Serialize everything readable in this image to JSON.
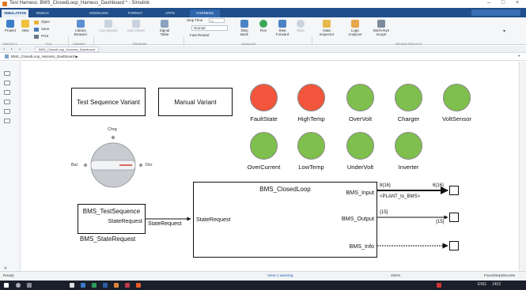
{
  "window": {
    "title": "Test Harness: BMS_ClosedLoop_Harness_Dashboard * - Simulink",
    "min": "–",
    "max": "□",
    "close": "×"
  },
  "tabs": [
    "SIMULATION",
    "DEBUG",
    "MODELING",
    "FORMAT",
    "APPS",
    "HARNESS"
  ],
  "ribbon": {
    "file": {
      "project": "Project",
      "new": "New",
      "open": "Open",
      "save": "Save",
      "print": "Print",
      "library": "Library Browser"
    },
    "prepare": {
      "log": "Log Signals",
      "add_viewer": "Add Viewer",
      "signal_table": "Signal Table"
    },
    "simulate": {
      "stop_time_label": "Stop Time",
      "stop_time": "inf",
      "mode": "Normal",
      "fast_restart": "Fast Restart",
      "step_back": "Step Back",
      "run": "Run",
      "step_fwd": "Step Forward",
      "stop": "Stop"
    },
    "review": {
      "data_inspector": "Data Inspector",
      "logic_analyzer": "Logic Analyzer",
      "bird_eye": "Bird's-Eye Scope"
    },
    "groups": [
      "PROJECT",
      "FILE",
      "LIBRARY",
      "PREPARE",
      "SIMULATE",
      "REVIEW RESULTS"
    ]
  },
  "model_tab": "BMS_ClosedLoop_Harness_Dashboard",
  "breadcrumb": "BMS_ClosedLoop_Harness_Dashboard ▶",
  "diagram": {
    "variant1": "Test Sequence Variant",
    "variant2": "Manual Variant",
    "lamps": [
      {
        "label": "FaultState",
        "color": "#f2553b"
      },
      {
        "label": "HighTemp",
        "color": "#f2553b"
      },
      {
        "label": "OverVolt",
        "color": "#7fbf4d"
      },
      {
        "label": "Charger",
        "color": "#7fbf4d"
      },
      {
        "label": "VoltSensor",
        "color": "#7fbf4d"
      },
      {
        "label": "OverCurrent",
        "color": "#7fbf4d"
      },
      {
        "label": "LowTemp",
        "color": "#7fbf4d"
      },
      {
        "label": "UnderVolt",
        "color": "#7fbf4d"
      },
      {
        "label": "Inverter",
        "color": "#7fbf4d"
      }
    ],
    "knob": {
      "top": "Chrg",
      "left": "Bal",
      "right": "Drv"
    },
    "test_seq": {
      "title": "BMS_TestSequence",
      "port": "StateRequest",
      "caption": "BMS_StateRequest"
    },
    "signal_state": "StateRequest",
    "closed_loop": {
      "title": "BMS_ClosedLoop",
      "in_port": "StateRequest",
      "out1": "BMS_Input",
      "out2": "BMS_Output",
      "out3": "BMS_Info"
    },
    "sig_input": "8{16}",
    "sig_input_out": "6{16}",
    "bus_label": "<PLANT_to_BMS>",
    "sig_output": "{15}",
    "sig_output_out": "{15}"
  },
  "status": {
    "ready": "Ready",
    "warning": "View 1 warning",
    "zoom": "200%",
    "solver": "FixedStepDiscrete"
  },
  "taskbar": {
    "lang": "ENG",
    "time": "1402"
  }
}
